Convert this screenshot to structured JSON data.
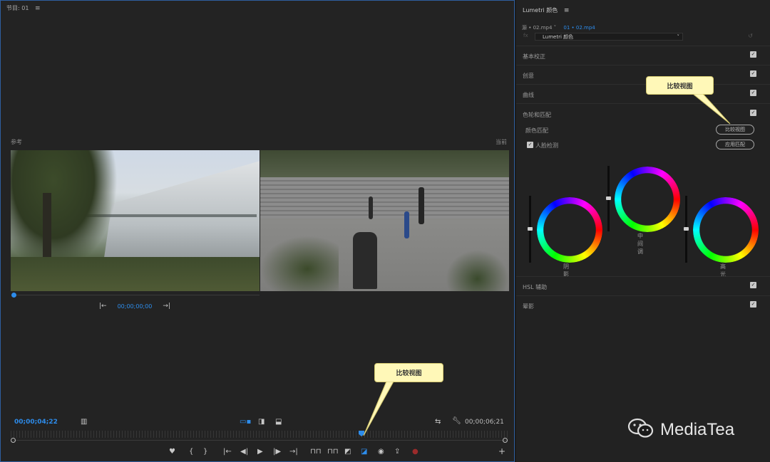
{
  "monitor": {
    "title": "节目: 01",
    "menu_icon": "hamburger-icon",
    "reference_label": "参考",
    "current_label": "当前",
    "reference_timecode": "00;00;00;00",
    "current_timecode": "00;00;04;22",
    "duration_timecode": "00;00;06;21"
  },
  "callouts": {
    "top": "比较视图",
    "bottom": "比较视图"
  },
  "lumetri": {
    "title": "Lumetri 颜色",
    "source_clip": "源 • 02.mp4",
    "sequence_clip": "01 • 02.mp4",
    "preset": "Lumetri 颜色",
    "sections": [
      {
        "label": "基本校正",
        "checked": true
      },
      {
        "label": "创意",
        "checked": true
      },
      {
        "label": "曲线",
        "checked": true
      },
      {
        "label": "色轮和匹配",
        "checked": true
      }
    ],
    "color_match_label": "颜色匹配",
    "compare_view_button": "比较视图",
    "face_detect_label": "人脸检测",
    "apply_match_button": "应用匹配",
    "wheels": [
      {
        "label": "阴影"
      },
      {
        "label": "中间调"
      },
      {
        "label": "高光"
      }
    ],
    "bottom_sections": [
      {
        "label": "HSL 辅助",
        "checked": true
      },
      {
        "label": "晕影",
        "checked": true
      }
    ]
  },
  "watermark": {
    "text": "MediaTea",
    "icon": "wechat-icon"
  },
  "colors": {
    "accent": "#2d8ceb",
    "panel_bg": "#222222",
    "callout_bg": "#fff8b8"
  }
}
